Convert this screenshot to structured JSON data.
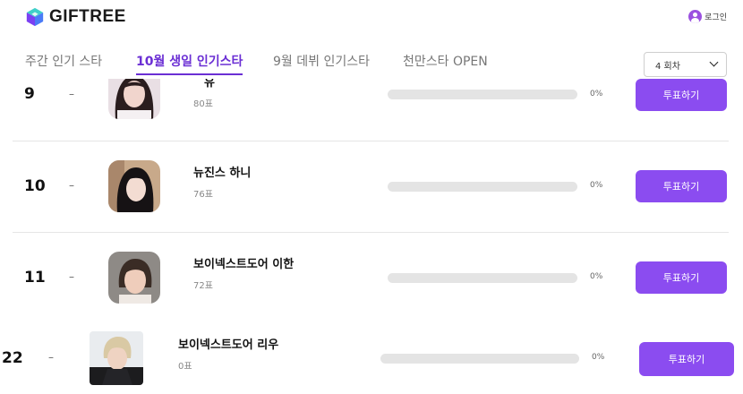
{
  "header": {
    "brand": "GIFTREE",
    "login_label": "로그인"
  },
  "tabs": [
    {
      "label": "주간 인기 스타",
      "active": false
    },
    {
      "label": "10월 생일 인기스타",
      "active": true
    },
    {
      "label": "9월 데뷔 인기스타",
      "active": false
    },
    {
      "label": "천만스타 OPEN",
      "active": false
    }
  ],
  "round_select": {
    "value": "4 회차"
  },
  "rankings": [
    {
      "rank": "9",
      "change": "–",
      "name": "유",
      "votes": "80표",
      "percent": "0%",
      "button": "투표하기"
    },
    {
      "rank": "10",
      "change": "–",
      "name": "뉴진스 하니",
      "votes": "76표",
      "percent": "0%",
      "button": "투표하기"
    },
    {
      "rank": "11",
      "change": "–",
      "name": "보이넥스트도어 이한",
      "votes": "72표",
      "percent": "0%",
      "button": "투표하기"
    },
    {
      "rank": "22",
      "change": "–",
      "name": "보이넥스트도어 리우",
      "votes": "0표",
      "percent": "0%",
      "button": "투표하기"
    }
  ],
  "colors": {
    "accent": "#8b4cf0",
    "tab_active": "#6b2fd4"
  }
}
